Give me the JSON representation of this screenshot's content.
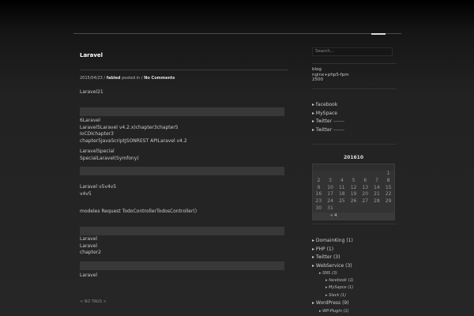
{
  "post": {
    "title": "Laravel",
    "date": "2015/04/23",
    "slash1": "/",
    "author": "fabled",
    "posted_in": "posted in",
    "slash2": "/",
    "comments": "No Comments",
    "lines": [
      "Laravel21",
      "6Laravel",
      "Laravel5Laravel v4.2.x)chapter3chapter5",
      "IoCDIchapter3",
      "chapter5JavaScriptJSONREST APILaravel v4.2",
      "LaravelSpecial",
      "SpecialLaravel(Symfony)",
      "Laravel v5v4v5",
      "v4v5",
      "modeles   Request    TodoControllerTodosController()",
      "Laravel",
      "Laravel",
      "chapter2",
      "Laravel"
    ],
    "tags": "< NO TAGS >"
  },
  "sidebar": {
    "search_placeholder": "Search...",
    "about": [
      "blog",
      "nginx+php5-fpm",
      "2500"
    ],
    "links": [
      "facebook",
      "MySpace",
      "Twitter",
      "Twitter"
    ],
    "calendar": {
      "title": "201610",
      "rows": [
        [
          "",
          "",
          "",
          "",
          "",
          "",
          "1"
        ],
        [
          "2",
          "3",
          "4",
          "5",
          "6",
          "7",
          "8"
        ],
        [
          "9",
          "10",
          "11",
          "12",
          "13",
          "14",
          "15"
        ],
        [
          "16",
          "17",
          "18",
          "19",
          "20",
          "21",
          "22"
        ],
        [
          "23",
          "24",
          "25",
          "26",
          "27",
          "28",
          "29"
        ],
        [
          "30",
          "31",
          "",
          "",
          "",
          "",
          ""
        ]
      ],
      "prev": "« 4"
    },
    "categories": [
      {
        "name": "DomainKing",
        "count": "(1)"
      },
      {
        "name": "PHP",
        "count": "(1)"
      },
      {
        "name": "Twitter",
        "count": "(3)"
      },
      {
        "name": "WebService",
        "count": "(3)"
      },
      {
        "name": "WordPress",
        "count": "(9)"
      }
    ],
    "webservice_sub": {
      "name": "SNS",
      "count": "(3)"
    },
    "sns_sub": [
      {
        "name": "facebook",
        "count": "(1)"
      },
      {
        "name": "MySapce",
        "count": "(1)"
      },
      {
        "name": "Slack",
        "count": "(1)"
      }
    ],
    "wordpress_sub": {
      "name": "WP-Plugin",
      "count": "(1)"
    }
  }
}
